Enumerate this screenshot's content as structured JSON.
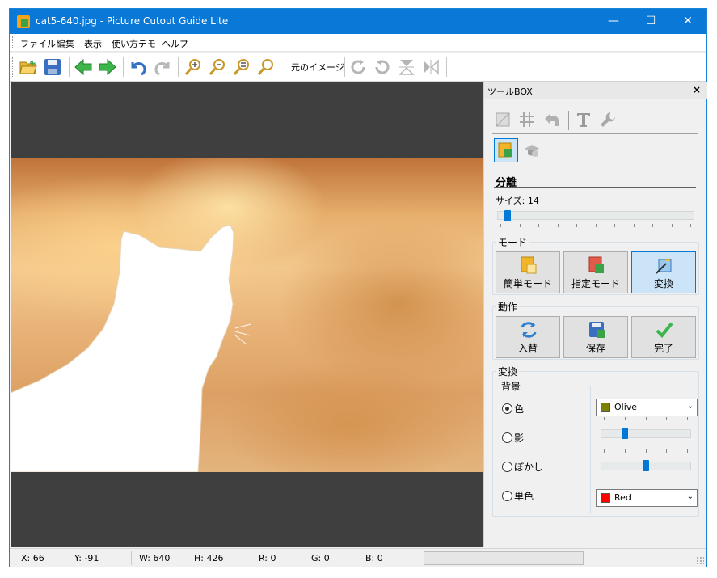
{
  "window": {
    "title": "cat5-640.jpg - Picture Cutout Guide Lite",
    "minimize_glyph": "—",
    "maximize_glyph": "☐",
    "close_glyph": "✕"
  },
  "menu": [
    "ファイル",
    "編集",
    "表示",
    "使い方デモ",
    "ヘルプ"
  ],
  "toolbar": {
    "icons": [
      "open-folder-icon",
      "save-icon",
      "back-arrow-icon",
      "forward-arrow-icon",
      "undo-icon",
      "redo-icon",
      "zoom-in-icon",
      "zoom-out-icon",
      "zoom-fit-icon",
      "zoom-actual-icon",
      "rotate-right-icon",
      "rotate-left-icon",
      "flip-vertical-icon",
      "flip-horizontal-icon"
    ],
    "original_image_label": "元のイメージ"
  },
  "toolbox": {
    "title": "ツールBOX",
    "close_glyph": "×",
    "top_icons": [
      "crop-icon",
      "grid-icon",
      "undo-arrow-icon",
      "text-icon",
      "wrench-icon"
    ],
    "mode_icons": [
      "separate-tool-icon",
      "hat-icon"
    ],
    "section_title": "分離",
    "size_label": "サイズ: 14",
    "size_value": 14,
    "mode_group": {
      "title": "モード",
      "buttons": [
        {
          "label": "簡単モード",
          "icon": "easy-mode-icon",
          "active": false
        },
        {
          "label": "指定モード",
          "icon": "specify-mode-icon",
          "active": false
        },
        {
          "label": "変換",
          "icon": "convert-icon",
          "active": true
        }
      ]
    },
    "action_group": {
      "title": "動作",
      "buttons": [
        {
          "label": "入替",
          "icon": "swap-icon"
        },
        {
          "label": "保存",
          "icon": "save-icon"
        },
        {
          "label": "完了",
          "icon": "checkmark-icon"
        }
      ]
    },
    "convert_group": {
      "title": "変換",
      "background_title": "背景",
      "options": [
        "色",
        "影",
        "ぼかし",
        "単色"
      ],
      "selected": "色",
      "color_combo": {
        "value": "Olive",
        "swatch": "#808000"
      },
      "shadow_level": 0.25,
      "blur_level": 0.5,
      "mono_combo": {
        "value": "Red",
        "swatch": "#ff0000"
      }
    }
  },
  "status": {
    "x": "X: 66",
    "y": "Y: -91",
    "w": "W: 640",
    "h": "H: 426",
    "r": "R: 0",
    "g": "G: 0",
    "b": "B: 0"
  },
  "colors": {
    "titlebar": "#0a78d7",
    "canvas_bg": "#3f3f3f",
    "accent": "#0078d7"
  }
}
